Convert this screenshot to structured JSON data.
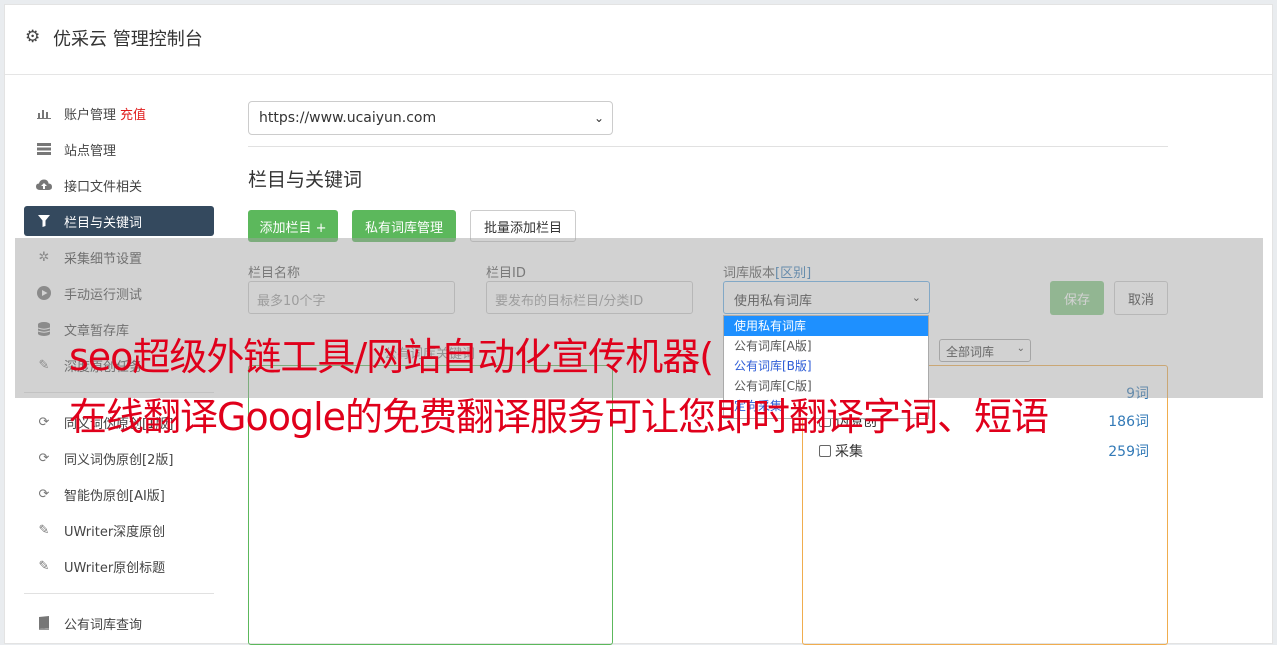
{
  "header": {
    "title": "优采云 管理控制台",
    "icon": "gear-icon"
  },
  "sidebar": {
    "items": [
      {
        "label": "账户管理",
        "badge": "充值",
        "icon": "bar-chart-icon"
      },
      {
        "label": "站点管理",
        "icon": "server-icon"
      },
      {
        "label": "接口文件相关",
        "icon": "cloud-upload-icon"
      },
      {
        "label": "栏目与关键词",
        "icon": "filter-icon",
        "active": true
      },
      {
        "label": "采集细节设置",
        "icon": "cogs-icon"
      },
      {
        "label": "手动运行测试",
        "icon": "play-circle-icon"
      },
      {
        "label": "文章暂存库",
        "icon": "database-icon"
      },
      {
        "label": "深度原创任务",
        "icon": "edit-icon"
      },
      {
        "label": "同义词伪原创[1版]",
        "icon": "refresh-icon"
      },
      {
        "label": "同义词伪原创[2版]",
        "icon": "refresh-icon"
      },
      {
        "label": "智能伪原创[AI版]",
        "icon": "refresh-icon"
      },
      {
        "label": "UWriter深度原创",
        "icon": "edit-icon"
      },
      {
        "label": "UWriter原创标题",
        "icon": "edit-icon"
      },
      {
        "label": "公有词库查询",
        "icon": "book-icon"
      }
    ]
  },
  "main": {
    "site_select": "https://www.ucaiyun.com",
    "section_title": "栏目与关键词",
    "buttons": {
      "add_category": "添加栏目 +",
      "private_lexicon": "私有词库管理",
      "batch_add": "批量添加栏目"
    },
    "form": {
      "name_label": "栏目名称",
      "name_placeholder": "最多10个字",
      "id_label": "栏目ID",
      "id_placeholder": "要发布的目标栏目/分类ID",
      "version_label": "词库版本",
      "version_link": "[区别]",
      "version_value": "使用私有词库",
      "save": "保存",
      "cancel": "取消"
    },
    "dropdown_options": [
      "使用私有词库",
      "公有词库[A版]",
      "公有词库[B版]",
      "公有词库[C版]",
      "定向采集"
    ],
    "filter_select": "全部词库",
    "faint_tab": "公有词库关键词",
    "lexicon_rows": [
      {
        "label": "伪原创",
        "count": "186词"
      },
      {
        "label": "采集",
        "count": "259词"
      }
    ],
    "partial_count": "9词"
  },
  "watermark": {
    "line1": "seo超级外链工具/网站自动化宣传机器(",
    "line2": "在线翻译Google的免费翻译服务可让您即时翻译字词、短语"
  },
  "colors": {
    "active_bg": "#34495e",
    "green": "#5cb85c",
    "watermark": "#e0001b",
    "link": "#337ab7"
  }
}
